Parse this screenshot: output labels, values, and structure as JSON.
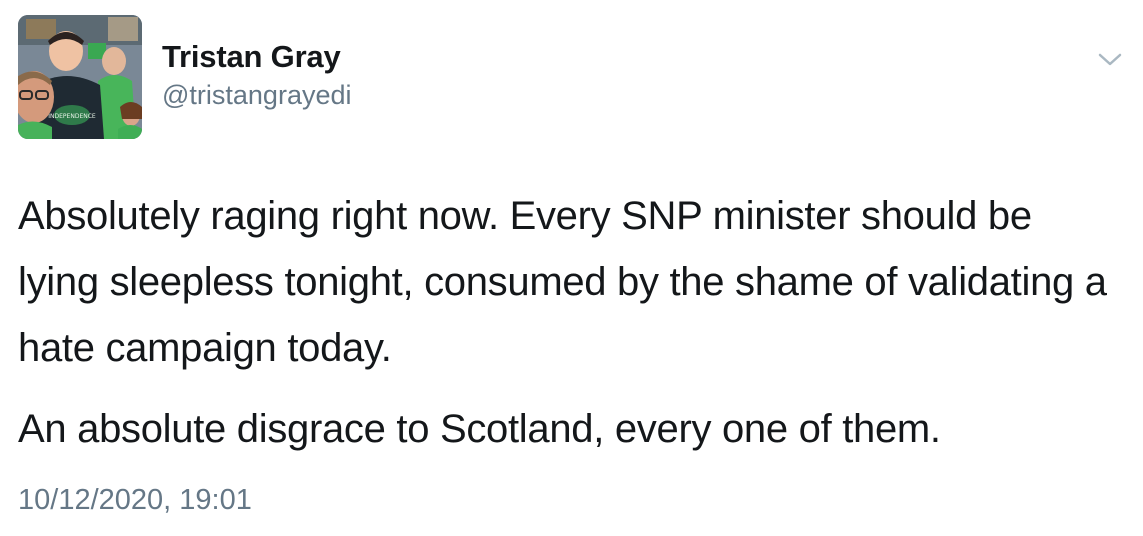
{
  "tweet": {
    "author": {
      "display_name": "Tristan Gray",
      "handle": "@tristangrayedi"
    },
    "paragraphs": [
      "Absolutely raging right now. Every SNP minister should be lying sleepless tonight, consumed by the shame of validating a hate campaign today.",
      "An absolute disgrace to Scotland, every one of them."
    ],
    "timestamp": "10/12/2020, 19:01",
    "avatar_badge_text": "INDEPENDENCE",
    "icons": {
      "menu": "chevron-down-icon"
    },
    "colors": {
      "text_primary": "#14171a",
      "text_secondary": "#657786",
      "chevron": "#aab8c2",
      "background": "#ffffff"
    }
  }
}
